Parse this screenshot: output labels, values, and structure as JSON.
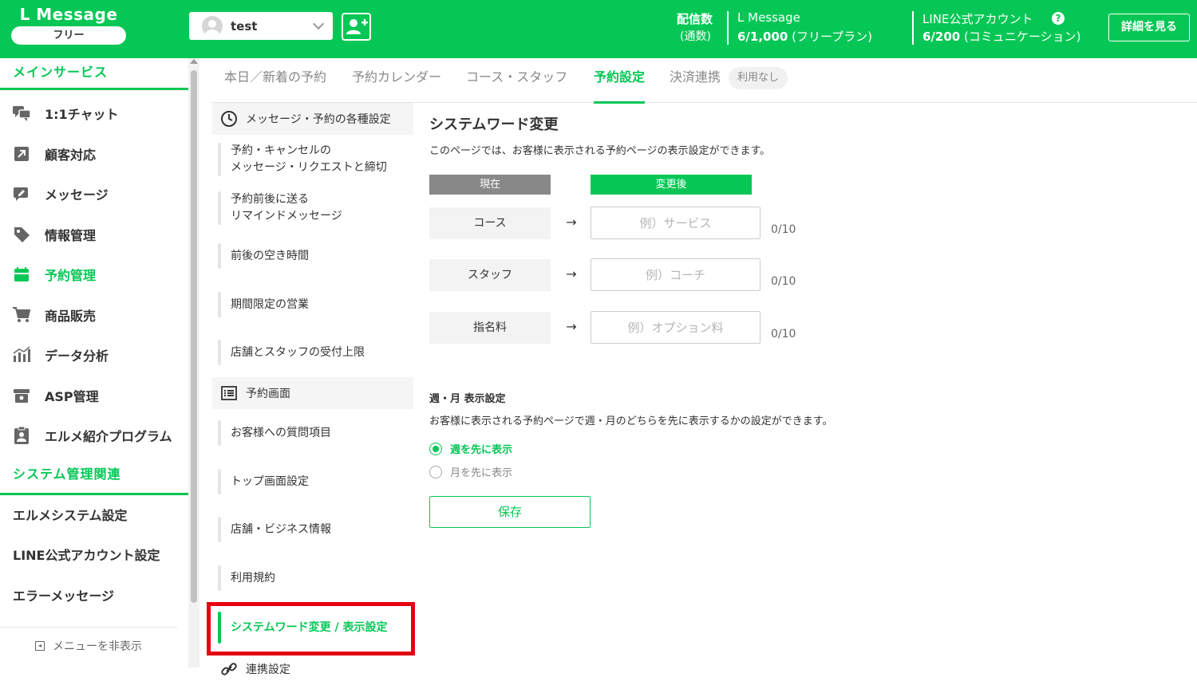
{
  "header": {
    "brand_name": "L Message",
    "brand_plan": "フリー",
    "account_name": "test",
    "delivery_label": "配信数",
    "delivery_sub": "(通数)",
    "lmessage_label": "L Message",
    "lmessage_count": "6/1,000",
    "lmessage_plan": "(フリープラン)",
    "line_label": "LINE公式アカウント",
    "line_count": "6/200",
    "line_plan": "(コミュニケーション)",
    "help": "?",
    "detail_button": "詳細を見る"
  },
  "sidebar": {
    "main_section": "メインサービス",
    "items": [
      {
        "label": "1:1チャット",
        "icon": "chat-icon"
      },
      {
        "label": "顧客対応",
        "icon": "arrow-up-right-icon"
      },
      {
        "label": "メッセージ",
        "icon": "edit-message-icon"
      },
      {
        "label": "情報管理",
        "icon": "tag-icon"
      },
      {
        "label": "予約管理",
        "icon": "calendar-icon"
      },
      {
        "label": "商品販売",
        "icon": "cart-icon"
      },
      {
        "label": "データ分析",
        "icon": "bar-chart-icon"
      },
      {
        "label": "ASP管理",
        "icon": "box-icon"
      },
      {
        "label": "エルメ紹介プログラム",
        "icon": "clipboard-user-icon"
      }
    ],
    "system_section": "システム管理関連",
    "system_items": [
      "エルメシステム設定",
      "LINE公式アカウント設定",
      "エラーメッセージ"
    ],
    "hide_menu": "メニューを非表示"
  },
  "tabs": {
    "items": [
      "本日／新着の予約",
      "予約カレンダー",
      "コース・スタッフ",
      "予約設定",
      "決済連携"
    ],
    "badge": "利用なし",
    "active": "予約設定"
  },
  "settings_nav": {
    "group1": "メッセージ・予約の各種設定",
    "group1_items": [
      "予約・キャンセルの\nメッセージ・リクエストと締切",
      "予約前後に送る\nリマインドメッセージ",
      "前後の空き時間",
      "期間限定の営業",
      "店舗とスタッフの受付上限"
    ],
    "group2": "予約画面",
    "group2_items": [
      "お客様への質問項目",
      "トップ画面設定",
      "店舗・ビジネス情報",
      "利用規約",
      "システムワード変更 / 表示設定"
    ],
    "group3": "連携設定"
  },
  "main": {
    "title": "システムワード変更",
    "description": "このページでは、お客様に表示される予約ページの表示設定ができます。",
    "current_header": "現在",
    "new_header": "変更後",
    "arrow": "→",
    "words": [
      {
        "current": "コース",
        "placeholder": "例）サービス",
        "count": "0/10"
      },
      {
        "current": "スタッフ",
        "placeholder": "例）コーチ",
        "count": "0/10"
      },
      {
        "current": "指名料",
        "placeholder": "例）オプション料",
        "count": "0/10"
      }
    ],
    "display_title": "週・月 表示設定",
    "display_desc": "お客様に表示される予約ページで週・月のどちらを先に表示するかの設定ができます。",
    "option_week": "週を先に表示",
    "option_month": "月を先に表示",
    "selected": "週を先に表示",
    "save": "保存"
  },
  "colors": {
    "brand": "#06c755",
    "highlight": "#e50012"
  }
}
